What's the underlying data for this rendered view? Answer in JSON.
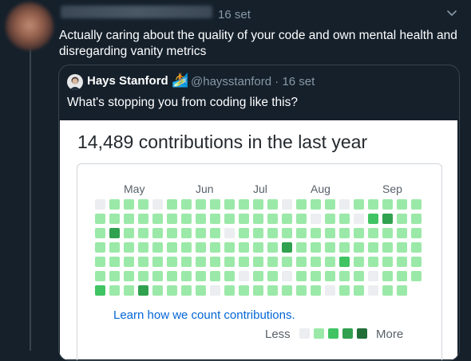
{
  "tweet": {
    "date": "16 set",
    "text": "Actually caring about the quality of your code and own mental health and disregarding vanity metrics"
  },
  "quoted_tweet": {
    "name": "Hays Stanford",
    "emoji": "🏄",
    "handle_date": "@haysstanford · 16 set",
    "text": "What's stopping you from coding like this?"
  },
  "contrib_card": {
    "title": "14,489 contributions in the last year",
    "months": [
      "May",
      "Jun",
      "Jul",
      "Aug",
      "Sep"
    ],
    "learn_link": "Learn how we count contributions.",
    "legend_less": "Less",
    "legend_more": "More",
    "levels": [
      0,
      1,
      1,
      1,
      0,
      1,
      1,
      1,
      1,
      1,
      1,
      1,
      1,
      0,
      1,
      1,
      1,
      0,
      1,
      1,
      1,
      1,
      1,
      1,
      1,
      1,
      1,
      1,
      1,
      1,
      1,
      1,
      1,
      1,
      1,
      1,
      1,
      1,
      0,
      1,
      1,
      0,
      2,
      3,
      1,
      1,
      1,
      3,
      1,
      1,
      1,
      1,
      1,
      1,
      1,
      0,
      1,
      1,
      1,
      1,
      1,
      1,
      1,
      1,
      1,
      1,
      1,
      1,
      1,
      1,
      1,
      1,
      1,
      1,
      1,
      1,
      1,
      1,
      1,
      1,
      1,
      1,
      3,
      1,
      1,
      1,
      1,
      1,
      1,
      1,
      1,
      1,
      1,
      1,
      1,
      1,
      1,
      1,
      1,
      1,
      1,
      1,
      1,
      1,
      1,
      1,
      1,
      1,
      1,
      2,
      1,
      1,
      1,
      1,
      1,
      1,
      1,
      1,
      1,
      1,
      1,
      1,
      1,
      1,
      1,
      0,
      1,
      1,
      0,
      1,
      1,
      1,
      1,
      1,
      0,
      1,
      1,
      1,
      2,
      1,
      1,
      3,
      1,
      1,
      1,
      1,
      0,
      1,
      1,
      1,
      1,
      1,
      1,
      1,
      0,
      1,
      1,
      0,
      1,
      1
    ]
  },
  "colors": {
    "level0": "#ebedf0",
    "level1": "#9be9a8",
    "level2": "#40c463",
    "level3": "#30a14e",
    "level4": "#216e39",
    "background": "#15202b",
    "link": "#0366d6"
  }
}
